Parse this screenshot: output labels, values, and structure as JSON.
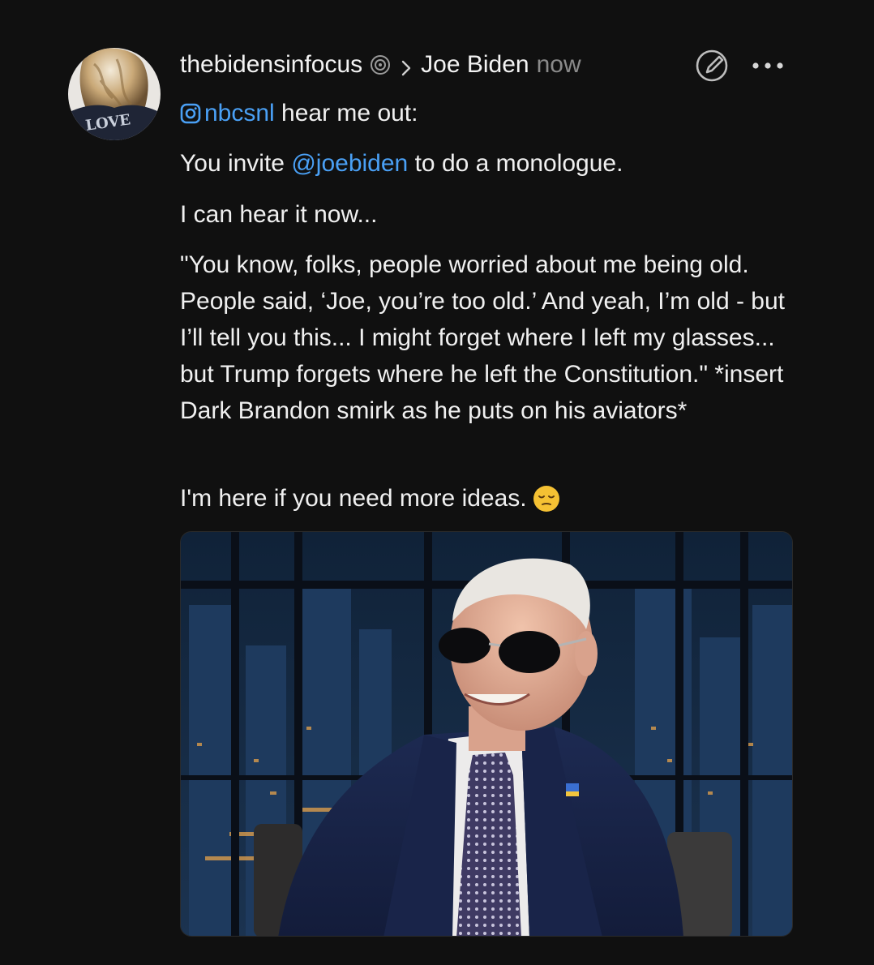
{
  "post": {
    "username": "thebidensinfocus",
    "reply_target": "Joe Biden",
    "timestamp": "now",
    "line1": {
      "mention": "nbcsnl",
      "text": " hear me out:"
    },
    "line2": {
      "prefix": "You invite ",
      "mention": "@joebiden",
      "suffix": " to do a monologue."
    },
    "line3": "I can hear it now...",
    "quote": "\"You know, folks, people worried about me being old. People said, ‘Joe, you’re too old.’ And yeah, I’m old - but I’ll tell you this... I might forget where I left my glasses... but Trump forgets where he left the Constitution.\" *insert Dark Brandon smirk as he puts on his aviators*",
    "closing": "I'm here if you need more ideas.",
    "avatar_text": "LOVE"
  },
  "icons": {
    "verified": "threads-verified-icon",
    "chevron": "chevron-right-icon",
    "edit": "edit-circle-icon",
    "more": "more-dots-icon",
    "instagram": "instagram-icon",
    "emoji": "relieved-face-emoji"
  },
  "colors": {
    "background": "#101010",
    "text": "#f3f3f3",
    "muted": "#8a8a8a",
    "mention": "#4aa0f5"
  }
}
